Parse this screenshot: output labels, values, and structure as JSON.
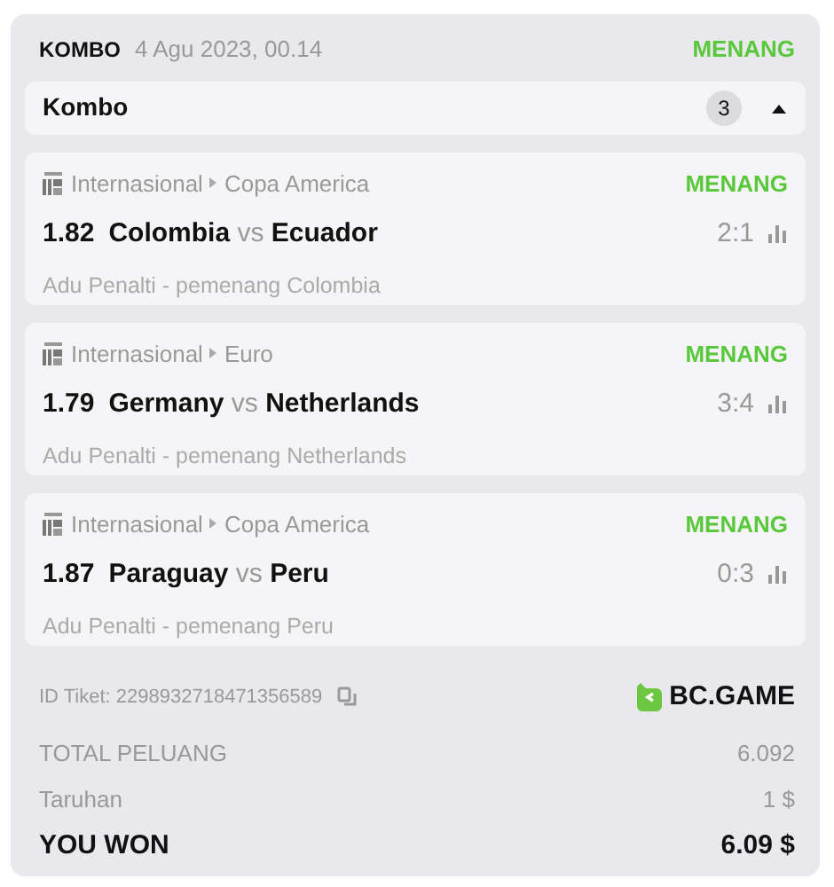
{
  "header": {
    "type": "KOMBO",
    "date": "4 Agu 2023, 00.14",
    "status": "MENANG"
  },
  "group": {
    "title": "Kombo",
    "count": "3",
    "expanded": true
  },
  "bets": [
    {
      "category": "Internasional",
      "league": "Copa America",
      "status": "MENANG",
      "odds": "1.82",
      "home": "Colombia",
      "vs": "vs",
      "away": "Ecuador",
      "score": "2:1",
      "market": "Adu Penalti - pemenang Colombia"
    },
    {
      "category": "Internasional",
      "league": "Euro",
      "status": "MENANG",
      "odds": "1.79",
      "home": "Germany",
      "vs": "vs",
      "away": "Netherlands",
      "score": "3:4",
      "market": "Adu Penalti - pemenang Netherlands"
    },
    {
      "category": "Internasional",
      "league": "Copa America",
      "status": "MENANG",
      "odds": "1.87",
      "home": "Paraguay",
      "vs": "vs",
      "away": "Peru",
      "score": "0:3",
      "market": "Adu Penalti - pemenang Peru"
    }
  ],
  "ticket": {
    "id": "ID Tiket: 2298932718471356589",
    "brand": "BC.GAME"
  },
  "summary": [
    {
      "kind": "muted",
      "label": "TOTAL PELUANG",
      "value": "6.092"
    },
    {
      "kind": "muted",
      "label": "Taruhan",
      "value": "1 $"
    },
    {
      "kind": "total",
      "label": "YOU WON",
      "value": "6.09 $"
    }
  ]
}
